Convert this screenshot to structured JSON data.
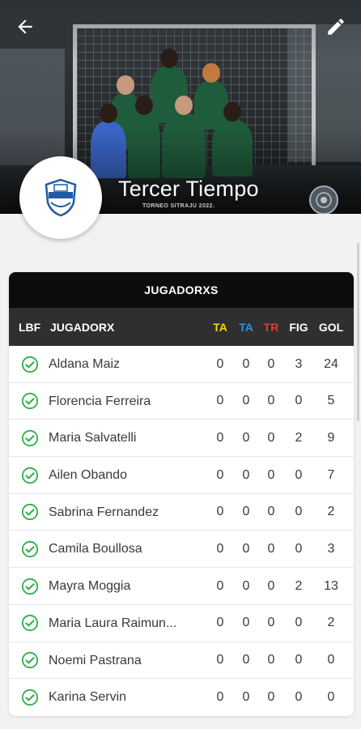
{
  "header": {
    "team_name": "Tercer Tiempo",
    "tournament": "TORNEO SITRAJU 2022.",
    "back_icon": "arrow-left-icon",
    "edit_icon": "pencil-icon",
    "logo_text": "TERCER TIEMPO"
  },
  "table": {
    "title": "JUGADORXS",
    "columns": {
      "lbf": "LBF",
      "player": "JUGADORX",
      "ta_yellow": "TA",
      "ta_blue": "TA",
      "tr": "TR",
      "fig": "FIG",
      "gol": "GOL"
    },
    "column_colors": {
      "ta_yellow": "#f5d800",
      "ta_blue": "#2f8fe6",
      "tr": "#e53935",
      "check": "#2eb049"
    },
    "rows": [
      {
        "name": "Aldana Maiz",
        "ta1": "0",
        "ta2": "0",
        "tr": "0",
        "fig": "3",
        "gol": "24"
      },
      {
        "name": "Florencia Ferreira",
        "ta1": "0",
        "ta2": "0",
        "tr": "0",
        "fig": "0",
        "gol": "5"
      },
      {
        "name": "Maria Salvatelli",
        "ta1": "0",
        "ta2": "0",
        "tr": "0",
        "fig": "2",
        "gol": "9"
      },
      {
        "name": "Ailen Obando",
        "ta1": "0",
        "ta2": "0",
        "tr": "0",
        "fig": "0",
        "gol": "7"
      },
      {
        "name": "Sabrina Fernandez",
        "ta1": "0",
        "ta2": "0",
        "tr": "0",
        "fig": "0",
        "gol": "2"
      },
      {
        "name": "Camila Boullosa",
        "ta1": "0",
        "ta2": "0",
        "tr": "0",
        "fig": "0",
        "gol": "3"
      },
      {
        "name": "Mayra Moggia",
        "ta1": "0",
        "ta2": "0",
        "tr": "0",
        "fig": "2",
        "gol": "13"
      },
      {
        "name": "Maria Laura Raimun...",
        "ta1": "0",
        "ta2": "0",
        "tr": "0",
        "fig": "0",
        "gol": "2"
      },
      {
        "name": "Noemi Pastrana",
        "ta1": "0",
        "ta2": "0",
        "tr": "0",
        "fig": "0",
        "gol": "0"
      },
      {
        "name": "Karina Servin",
        "ta1": "0",
        "ta2": "0",
        "tr": "0",
        "fig": "0",
        "gol": "0"
      }
    ]
  }
}
